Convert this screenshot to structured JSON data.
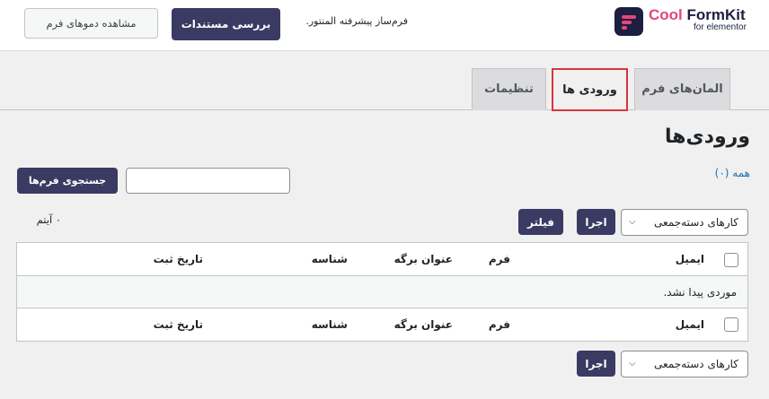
{
  "header": {
    "logo_word1": "Cool",
    "logo_word2": "FormKit",
    "logo_sub": "for elementor",
    "tagline": "فرم‌ساز پیشرفته المنتور.",
    "docs_button": "بررسی مستندات",
    "demo_button": "مشاهده دموهای فرم"
  },
  "tabs": [
    {
      "label": "المان‌های فرم",
      "active": false
    },
    {
      "label": "ورودی ها",
      "active": true
    },
    {
      "label": "تنظیمات",
      "active": false
    }
  ],
  "page": {
    "title": "ورودی‌ها",
    "view_all": "همه (۰)",
    "search_placeholder": "",
    "search_button": "جستجوی فرم‌ها",
    "bulk_actions_label": "کارهای دسته‌جمعی",
    "apply_button": "اجرا",
    "filter_button": "فیلتر",
    "items_count": "۰ آیتم"
  },
  "table": {
    "columns": [
      "ایمیل",
      "فرم",
      "عنوان برگه",
      "شناسه",
      "تاریخ ثبت"
    ],
    "empty_message": "موردی پیدا نشد."
  },
  "colors": {
    "brand_pink": "#e5467c",
    "brand_navy": "#1c1f3f",
    "button_dark": "#3a3a63",
    "link": "#2271b1",
    "active_tab_outline": "#d63638"
  }
}
